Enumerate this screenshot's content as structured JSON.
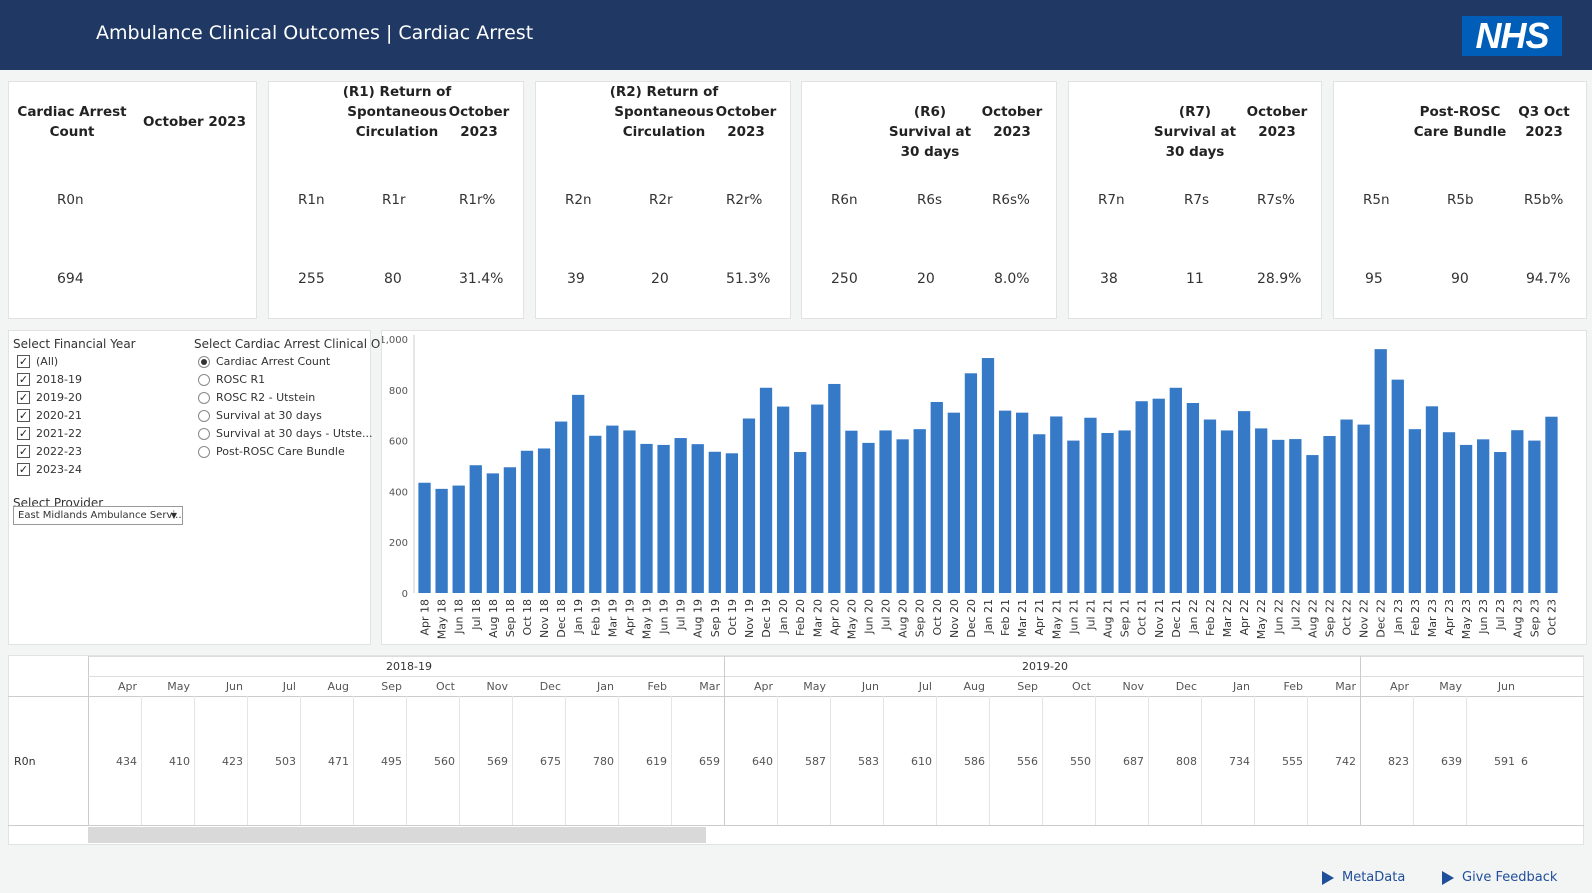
{
  "header": {
    "title": "Ambulance Clinical Outcomes | Cardiac Arrest",
    "logo": "NHS"
  },
  "kpis": [
    {
      "heads": [
        "Cardiac Arrest Count",
        "October 2023"
      ],
      "labels": [
        "R0n"
      ],
      "values": [
        "694"
      ]
    },
    {
      "heads": [
        "(R1) Return of Spontaneous Circulation",
        "October 2023"
      ],
      "labels": [
        "R1n",
        "R1r",
        "R1r%"
      ],
      "values": [
        "255",
        "80",
        "31.4%"
      ]
    },
    {
      "heads": [
        "(R2) Return of Spontaneous Circulation",
        "October 2023"
      ],
      "labels": [
        "R2n",
        "R2r",
        "R2r%"
      ],
      "values": [
        "39",
        "20",
        "51.3%"
      ]
    },
    {
      "heads": [
        "(R6) Survival at 30 days",
        "October 2023"
      ],
      "labels": [
        "R6n",
        "R6s",
        "R6s%"
      ],
      "values": [
        "250",
        "20",
        "8.0%"
      ]
    },
    {
      "heads": [
        "(R7) Survival at 30 days",
        "October 2023"
      ],
      "labels": [
        "R7n",
        "R7s",
        "R7s%"
      ],
      "values": [
        "38",
        "11",
        "28.9%"
      ]
    },
    {
      "heads": [
        "Post-ROSC Care Bundle",
        "Q3 Oct 2023"
      ],
      "labels": [
        "R5n",
        "R5b",
        "R5b%"
      ],
      "values": [
        "95",
        "90",
        "94.7%"
      ]
    }
  ],
  "filters": {
    "year_title": "Select Financial Year",
    "years": [
      "(All)",
      "2018-19",
      "2019-20",
      "2020-21",
      "2021-22",
      "2022-23",
      "2023-24"
    ],
    "outcome_title": "Select Cardiac Arrest Clinical O...",
    "outcomes": [
      "Cardiac Arrest Count",
      "ROSC R1",
      "ROSC R2 - Utstein",
      "Survival at 30 days",
      "Survival at 30 days - Utste...",
      "Post-ROSC Care Bundle"
    ],
    "selected_outcome": "Cardiac Arrest Count",
    "provider_title": "Select Provider",
    "provider_value": "East Midlands Ambulance Servi...",
    "dropdown_glyph": "▼",
    "check_glyph": "✓"
  },
  "chart_data": {
    "type": "bar",
    "categories": [
      "Apr 18",
      "May 18",
      "Jun 18",
      "Jul 18",
      "Aug 18",
      "Sep 18",
      "Oct 18",
      "Nov 18",
      "Dec 18",
      "Jan 19",
      "Feb 19",
      "Mar 19",
      "Apr 19",
      "May 19",
      "Jun 19",
      "Jul 19",
      "Aug 19",
      "Sep 19",
      "Oct 19",
      "Nov 19",
      "Dec 19",
      "Jan 20",
      "Feb 20",
      "Mar 20",
      "Apr 20",
      "May 20",
      "Jun 20",
      "Jul 20",
      "Aug 20",
      "Sep 20",
      "Oct 20",
      "Nov 20",
      "Dec 20",
      "Jan 21",
      "Feb 21",
      "Mar 21",
      "Apr 21",
      "May 21",
      "Jun 21",
      "Jul 21",
      "Aug 21",
      "Sep 21",
      "Oct 21",
      "Nov 21",
      "Dec 21",
      "Jan 22",
      "Feb 22",
      "Mar 22",
      "Apr 22",
      "May 22",
      "Jun 22",
      "Jul 22",
      "Aug 22",
      "Sep 22",
      "Oct 22",
      "Nov 22",
      "Dec 22",
      "Jan 23",
      "Feb 23",
      "Mar 23",
      "Apr 23",
      "May 23",
      "Jun 23",
      "Jul 23",
      "Aug 23",
      "Sep 23",
      "Oct 23"
    ],
    "values": [
      434,
      410,
      423,
      503,
      471,
      495,
      560,
      569,
      675,
      780,
      619,
      659,
      640,
      587,
      583,
      610,
      586,
      556,
      550,
      687,
      808,
      734,
      555,
      742,
      823,
      639,
      591,
      640,
      605,
      645,
      752,
      710,
      865,
      925,
      718,
      710,
      625,
      695,
      600,
      690,
      630,
      640,
      755,
      765,
      808,
      748,
      683,
      640,
      716,
      648,
      603,
      606,
      543,
      618,
      683,
      663,
      960,
      840,
      645,
      735,
      633,
      583,
      605,
      555,
      641,
      600,
      694
    ],
    "yticks": [
      "0",
      "200",
      "400",
      "600",
      "800",
      "1,000"
    ],
    "ylim": [
      0,
      1000
    ],
    "bar_color": "#3579c7",
    "grid": false
  },
  "table": {
    "row_label": "R0n",
    "years": [
      "2018-19",
      "2019-20"
    ],
    "months": [
      "Apr",
      "May",
      "Jun",
      "Jul",
      "Aug",
      "Sep",
      "Oct",
      "Nov",
      "Dec",
      "Jan",
      "Feb",
      "Mar",
      "Apr",
      "May",
      "Jun",
      "Jul",
      "Aug",
      "Sep",
      "Oct",
      "Nov",
      "Dec",
      "Jan",
      "Feb",
      "Mar",
      "Apr",
      "May",
      "Jun"
    ],
    "values": [
      "434",
      "410",
      "423",
      "503",
      "471",
      "495",
      "560",
      "569",
      "675",
      "780",
      "619",
      "659",
      "640",
      "587",
      "583",
      "610",
      "586",
      "556",
      "550",
      "687",
      "808",
      "734",
      "555",
      "742",
      "823",
      "639",
      "591"
    ],
    "trailing_value": "6"
  },
  "footer": {
    "metadata": "MetaData",
    "feedback": "Give Feedback"
  }
}
